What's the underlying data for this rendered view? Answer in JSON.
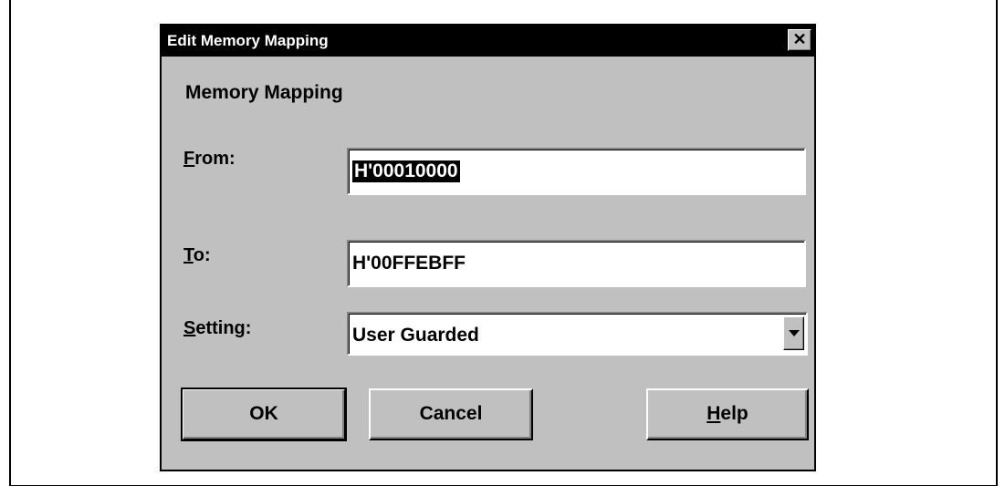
{
  "dialog": {
    "title": "Edit Memory Mapping",
    "close_glyph": "✕",
    "group_label": "Memory Mapping"
  },
  "fields": {
    "from": {
      "label_accel": "F",
      "label_rest": "rom:",
      "value": "H'00010000"
    },
    "to": {
      "label_accel": "T",
      "label_rest": "o:",
      "value": "H'00FFEBFF"
    },
    "setting": {
      "label_accel": "S",
      "label_rest": "etting:",
      "value": "User Guarded"
    }
  },
  "buttons": {
    "ok": "OK",
    "cancel": "Cancel",
    "help_accel": "H",
    "help_rest": "elp"
  },
  "colors": {
    "dialog_bg": "#c0c0c0",
    "titlebar_bg": "#000000",
    "selection_bg": "#000000"
  },
  "icons": {
    "close": "close-icon",
    "dropdown": "chevron-down-icon"
  }
}
